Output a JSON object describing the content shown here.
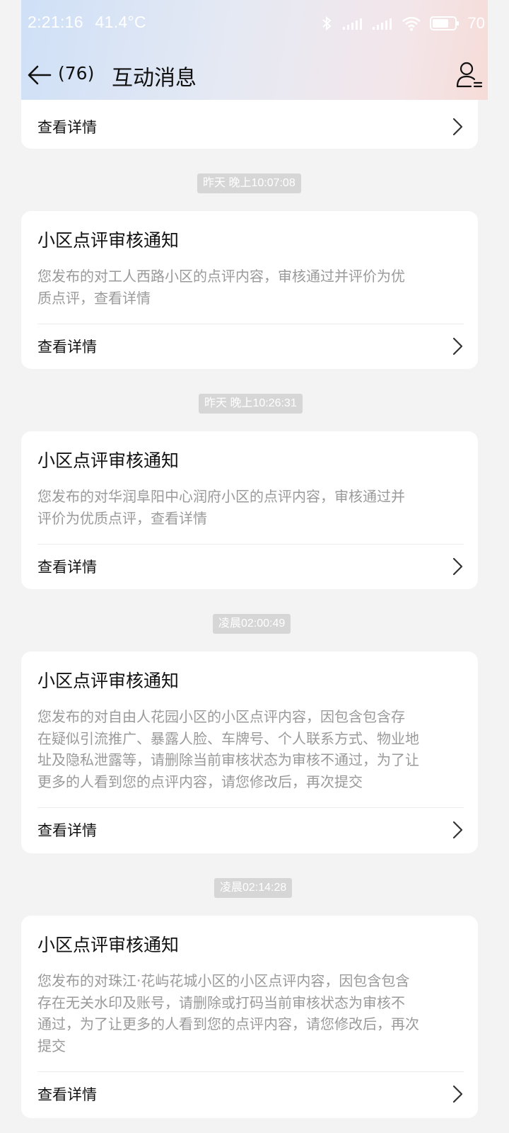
{
  "status_bar": {
    "time": "2:21:16",
    "temperature": "41.4°C",
    "battery": "70"
  },
  "header": {
    "unread_count": "(76)",
    "title": "互动消息"
  },
  "colors": {
    "card_bg": "#ffffff",
    "page_bg": "#f3f3f3",
    "body_text": "#9a9a9a",
    "badge_bg": "#d6d6d6"
  },
  "top_partial_card": {
    "link_label": "查看详情"
  },
  "messages": [
    {
      "timestamp": "昨天 晚上10:07:08",
      "title": "小区点评审核通知",
      "body_lines": [
        "您发布的对工人西路小区的点评内容，审核通过并评价为优",
        "质点评，查看详情"
      ],
      "link_label": "查看详情"
    },
    {
      "timestamp": "昨天 晚上10:26:31",
      "title": "小区点评审核通知",
      "body_lines": [
        "您发布的对华润阜阳中心润府小区的点评内容，审核通过并",
        "评价为优质点评，查看详情"
      ],
      "link_label": "查看详情"
    },
    {
      "timestamp": "凌晨02:00:49",
      "title": "小区点评审核通知",
      "body_lines": [
        "您发布的对自由人花园小区的小区点评内容，因包含包含存",
        "在疑似引流推广、暴露人脸、车牌号、个人联系方式、物业地",
        "址及隐私泄露等，请删除当前审核状态为审核不通过，为了让",
        "更多的人看到您的点评内容，请您修改后，再次提交"
      ],
      "link_label": "查看详情"
    },
    {
      "timestamp": "凌晨02:14:28",
      "title": "小区点评审核通知",
      "body_lines": [
        "您发布的对珠江·花屿花城小区的小区点评内容，因包含包含",
        "存在无关水印及账号，请删除或打码当前审核状态为审核不",
        "通过，为了让更多的人看到您的点评内容，请您修改后，再次",
        "提交"
      ],
      "link_label": "查看详情"
    }
  ]
}
